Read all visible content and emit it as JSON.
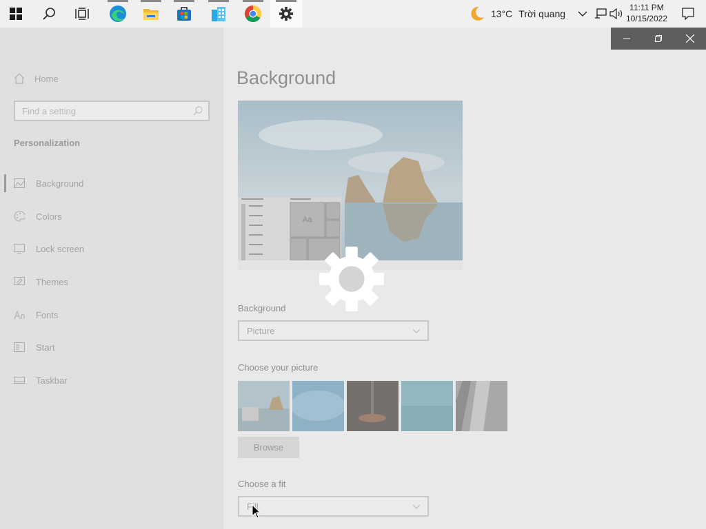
{
  "taskbar": {
    "weather_temp": "13°C",
    "weather_desc": "Trời quang",
    "time": "11:11 PM",
    "date": "10/15/2022"
  },
  "settings": {
    "home_label": "Home",
    "search_placeholder": "Find a setting",
    "section": "Personalization",
    "nav_items": [
      {
        "label": "Background",
        "icon": "picture-icon"
      },
      {
        "label": "Colors",
        "icon": "palette-icon"
      },
      {
        "label": "Lock screen",
        "icon": "lock-screen-icon"
      },
      {
        "label": "Themes",
        "icon": "themes-icon"
      },
      {
        "label": "Fonts",
        "icon": "fonts-icon"
      },
      {
        "label": "Start",
        "icon": "start-icon"
      },
      {
        "label": "Taskbar",
        "icon": "taskbar-icon"
      }
    ],
    "page_title": "Background",
    "preview_sample_text": "Aa",
    "background_label": "Background",
    "background_value": "Picture",
    "choose_picture_label": "Choose your picture",
    "browse_label": "Browse",
    "choose_fit_label": "Choose a fit",
    "fit_value": "Fill"
  },
  "colors": {
    "taskbar_bg": "#f0f0f0",
    "dim_overlay": "#e9e9e9",
    "window_controls_bg": "#5e5e5e"
  }
}
